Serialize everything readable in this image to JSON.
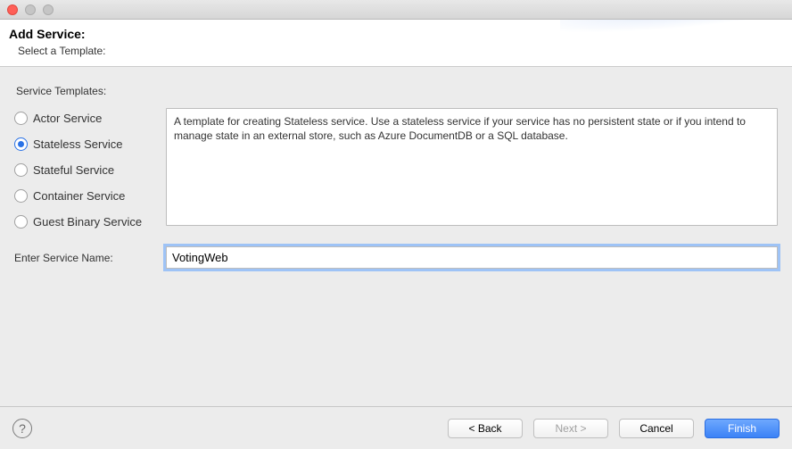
{
  "header": {
    "title": "Add Service:",
    "subtitle": "Select a Template:"
  },
  "panel": {
    "templates_label": "Service Templates:",
    "options": {
      "actor": "Actor Service",
      "stateless": "Stateless Service",
      "stateful": "Stateful Service",
      "container": "Container Service",
      "guest": "Guest Binary Service"
    },
    "selected": "stateless",
    "description": "A template for creating Stateless service.  Use a stateless service if your service has no persistent state or if you intend to manage state in an external store, such as Azure DocumentDB or a SQL database."
  },
  "name": {
    "label": "Enter Service Name:",
    "value": "VotingWeb"
  },
  "footer": {
    "back": "< Back",
    "next": "Next >",
    "cancel": "Cancel",
    "finish": "Finish"
  }
}
